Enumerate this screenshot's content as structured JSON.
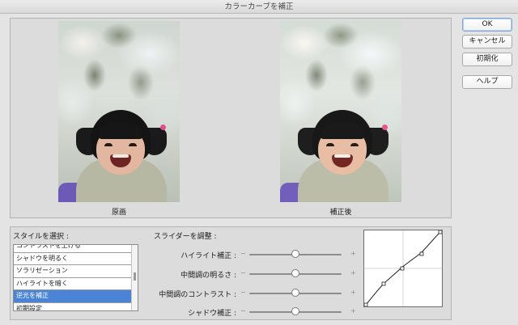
{
  "window": {
    "title": "カラーカーブを補正"
  },
  "preview": {
    "original_caption": "原画",
    "corrected_caption": "補正後"
  },
  "buttons": {
    "ok": "OK",
    "cancel": "キャンセル",
    "reset": "初期化",
    "help": "ヘルプ"
  },
  "styles": {
    "label": "スタイルを選択 :",
    "items": [
      "コントラストを上げる",
      "シャドウを明るく",
      "ソラリゼーション",
      "ハイライトを暗く",
      "逆光を補正",
      "初期設定"
    ],
    "selected": "逆光を補正"
  },
  "sliders": {
    "label": "スライダーを調整 :",
    "items": [
      {
        "label": "ハイライト補正 :",
        "value": 0.5
      },
      {
        "label": "中間調の明るさ :",
        "value": 0.5
      },
      {
        "label": "中間調のコントラスト :",
        "value": 0.5
      },
      {
        "label": "シャドウ補正 :",
        "value": 0.5
      }
    ],
    "minus": "−",
    "plus": "+"
  },
  "colors": {
    "selection": "#4b84d4",
    "default_button_border": "#7fa7d8"
  }
}
